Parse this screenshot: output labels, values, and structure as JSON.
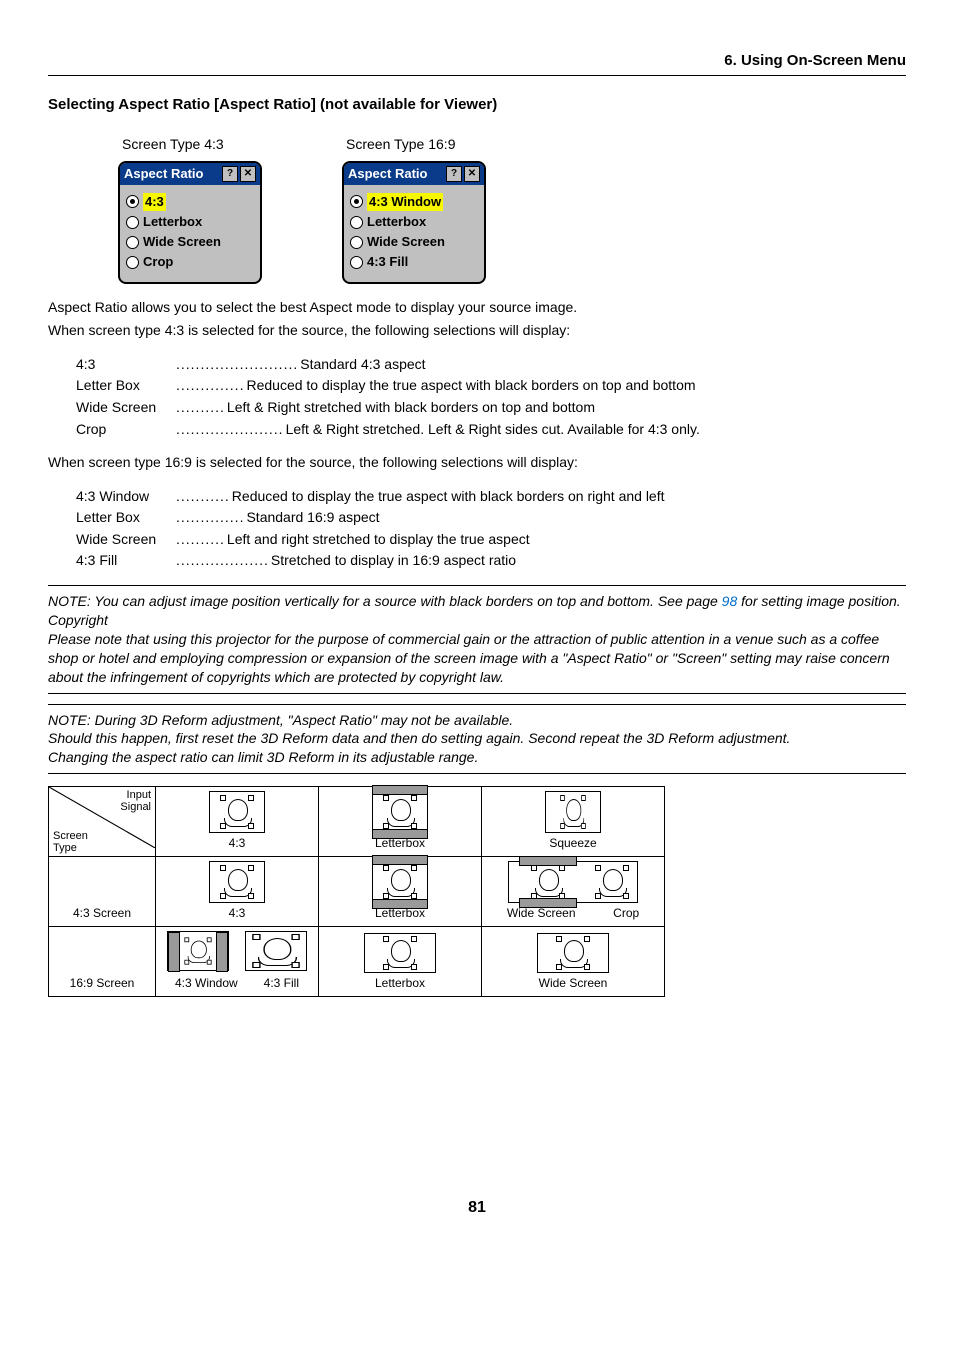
{
  "chapter": "6. Using On-Screen Menu",
  "section_title": "Selecting Aspect Ratio [Aspect Ratio] (not available for Viewer)",
  "dialog_left": {
    "caption": "Screen Type 4:3",
    "title": "Aspect Ratio",
    "options": [
      "4:3",
      "Letterbox",
      "Wide Screen",
      "Crop"
    ],
    "selected": 0
  },
  "dialog_right": {
    "caption": "Screen Type 16:9",
    "title": "Aspect Ratio",
    "options": [
      "4:3 Window",
      "Letterbox",
      "Wide Screen",
      "4:3 Fill"
    ],
    "selected": 0
  },
  "intro_p1": "Aspect Ratio allows you to select the best Aspect mode to display your source image.",
  "intro_p2": "When screen type 4:3 is selected for the source, the following selections will display:",
  "defs_43": [
    {
      "term": "4:3",
      "desc": "Standard 4:3 aspect"
    },
    {
      "term": "Letter Box",
      "desc": "Reduced to display the true aspect with black borders on top and bottom"
    },
    {
      "term": "Wide Screen",
      "desc": "Left & Right stretched with black borders on top and bottom"
    },
    {
      "term": "Crop",
      "desc": "Left & Right stretched. Left & Right sides cut. Available for 4:3 only."
    }
  ],
  "intro_p3": "When screen type 16:9 is selected for the source, the following selections will display:",
  "defs_169": [
    {
      "term": "4:3 Window",
      "desc": "Reduced to display the true aspect with black borders on right and left"
    },
    {
      "term": "Letter Box",
      "desc": "Standard 16:9 aspect"
    },
    {
      "term": "Wide Screen",
      "desc": "Left and right stretched to display the true aspect"
    },
    {
      "term": "4:3 Fill",
      "desc": "Stretched to display in 16:9 aspect ratio"
    }
  ],
  "note1_pre": "NOTE: You can adjust image position vertically for a source with black borders on top and bottom. See page ",
  "note1_link": "98",
  "note1_post": " for setting image position.",
  "copyright_label": "Copyright",
  "copyright_text": "Please note that using this projector for the purpose of commercial gain or the attraction of public attention in a venue such as a coffee shop or hotel and employing compression or expansion of the screen image with a \"Aspect Ratio\" or \"Screen\" setting may raise concern about the infringement of copyrights which are protected by copyright law.",
  "note2_l1": "NOTE: During 3D Reform adjustment, \"Aspect Ratio\" may not be available.",
  "note2_l2": "Should this happen, first reset the 3D Reform data and then do setting again. Second repeat the 3D Reform adjustment.",
  "note2_l3": "Changing the aspect ratio can limit 3D Reform in its adjustable range.",
  "table": {
    "hdr_input": "Input",
    "hdr_signal": "Signal",
    "hdr_screen": "Screen",
    "hdr_type": "Type",
    "col_43": "4:3",
    "col_lb": "Letterbox",
    "col_sq": "Squeeze",
    "row_43": "4:3 Screen",
    "row_43_c1": "4:3",
    "row_43_c2": "Letterbox",
    "row_43_c3a": "Wide Screen",
    "row_43_c3b": "Crop",
    "row_169": "16:9 Screen",
    "row_169_c1a": "4:3 Window",
    "row_169_c1b": "4:3 Fill",
    "row_169_c2": "Letterbox",
    "row_169_c3": "Wide Screen"
  },
  "page_number": "81"
}
